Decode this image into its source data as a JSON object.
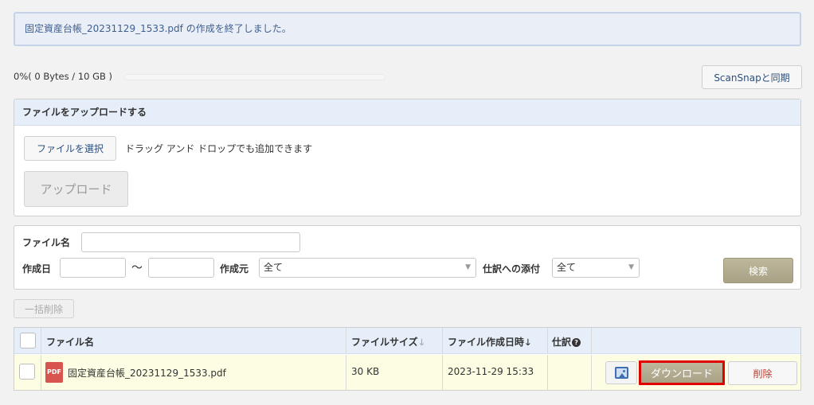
{
  "notice": {
    "message": "固定資産台帳_20231129_1533.pdf の作成を終了しました。"
  },
  "storage": {
    "usage_text": "0%( 0 Bytes / 10 GB )",
    "used_fraction": 0
  },
  "sync": {
    "label": "ScanSnapと同期"
  },
  "upload": {
    "title": "ファイルをアップロードする",
    "choose_label": "ファイルを選択",
    "drop_hint": "ドラッグ アンド ドロップでも追加できます",
    "upload_label": "アップロード"
  },
  "search": {
    "filename_label": "ファイル名",
    "filename_value": "",
    "created_label": "作成日",
    "date_from": "",
    "date_to": "",
    "tilde": "〜",
    "source_label": "作成元",
    "source_value": "全て",
    "attach_label": "仕訳への添付",
    "attach_value": "全て",
    "search_label": "検索"
  },
  "bulk_delete": {
    "label": "一括削除"
  },
  "table": {
    "headers": {
      "filename": "ファイル名",
      "size": "ファイルサイズ",
      "size_sort": "🡓",
      "created": "ファイル作成日時",
      "created_sort": "🡓",
      "journal": "仕訳",
      "journal_help": "?"
    },
    "rows": [
      {
        "icon": "PDF",
        "filename": "固定資産台帳_20231129_1533.pdf",
        "size": "30 KB",
        "created": "2023-11-29 15:33",
        "journal": "",
        "download_label": "ダウンロード",
        "delete_label": "削除"
      }
    ]
  },
  "colors": {
    "accent": "#b1aa8e",
    "highlight": "#e00000",
    "header_bg": "#e6eff9",
    "row_bg": "#fdfde3"
  }
}
